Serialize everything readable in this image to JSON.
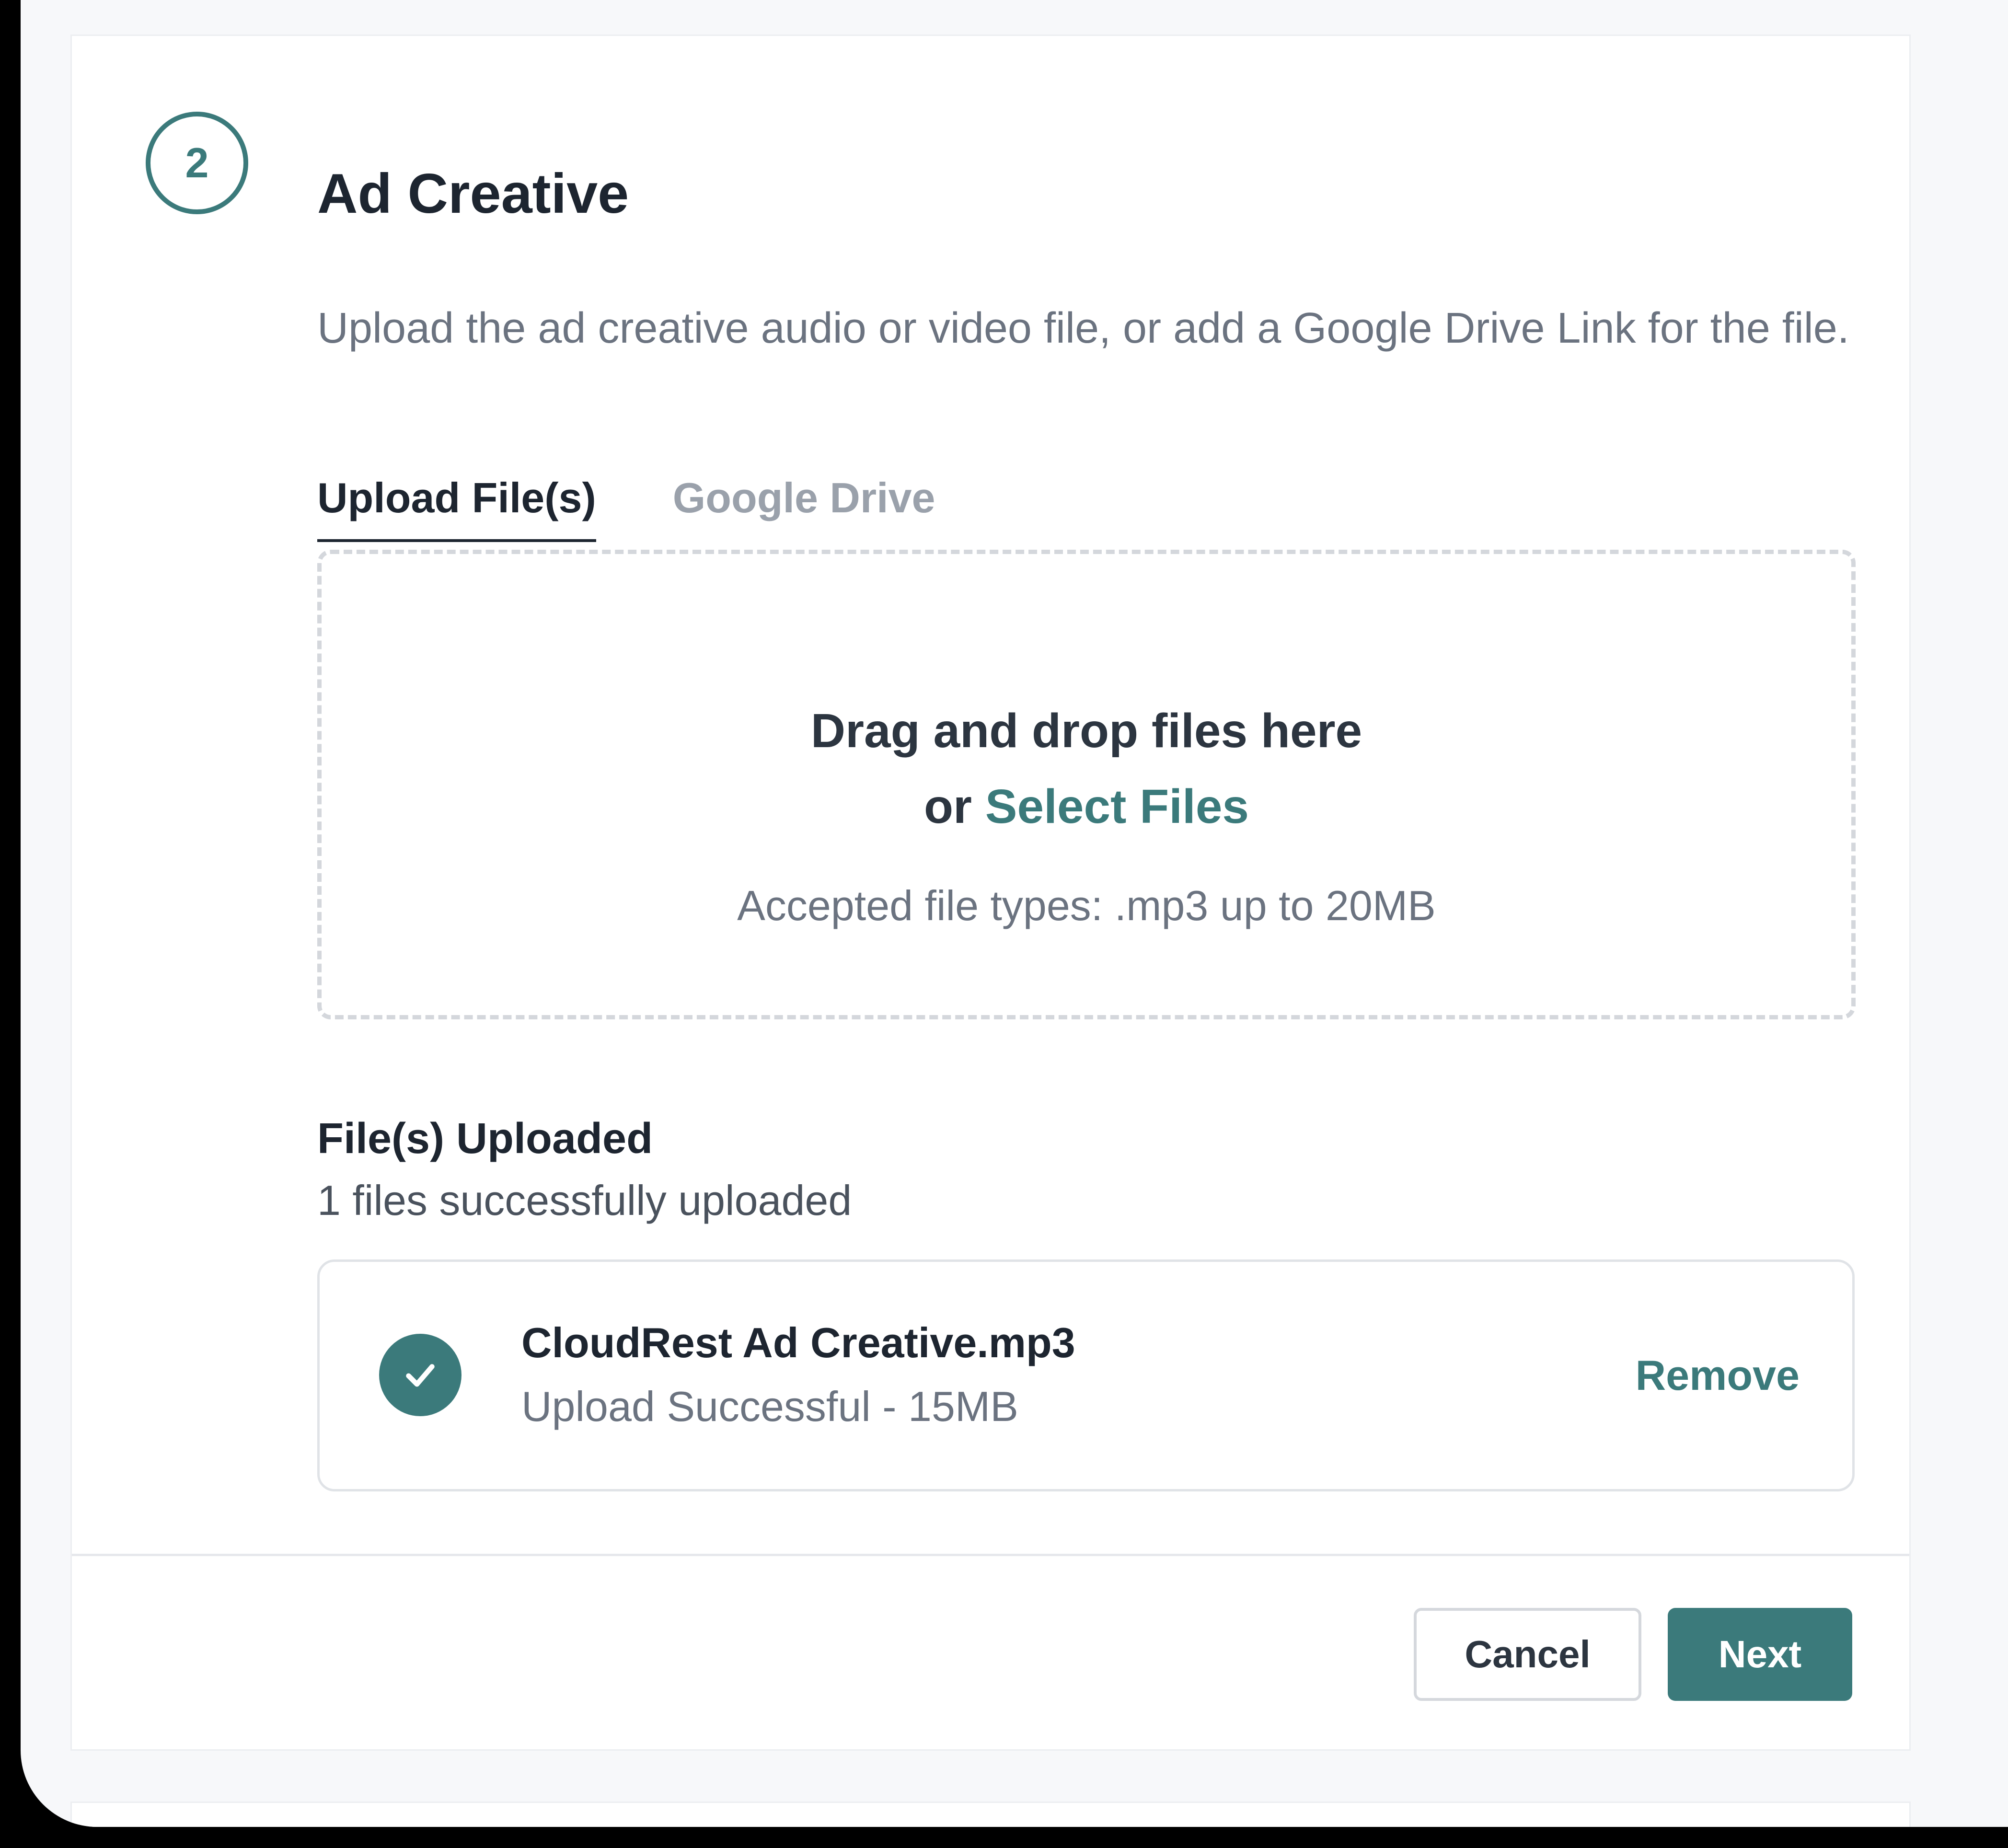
{
  "section": {
    "step_number": "2",
    "title": "Ad Creative",
    "description": "Upload the ad creative audio or video file, or add a Google Drive Link for the file."
  },
  "tabs": [
    {
      "label": "Upload File(s)",
      "active": true
    },
    {
      "label": "Google Drive",
      "active": false
    }
  ],
  "dropzone": {
    "line1": "Drag and drop files here",
    "or_text": "or",
    "select_link": "Select Files",
    "accepted": "Accepted file types: .mp3 up to 20MB"
  },
  "uploaded": {
    "title": "File(s) Uploaded",
    "count_text": "1 files successfully uploaded",
    "files": [
      {
        "name": "CloudRest Ad Creative.mp3",
        "status": "Upload Successful - 15MB",
        "remove_label": "Remove",
        "icon": "check-circle-icon"
      }
    ]
  },
  "footer": {
    "cancel_label": "Cancel",
    "next_label": "Next"
  },
  "colors": {
    "accent": "#3b7a7b",
    "heading": "#1d2530",
    "muted": "#6b7380",
    "page_bg": "#f7f8fa"
  }
}
